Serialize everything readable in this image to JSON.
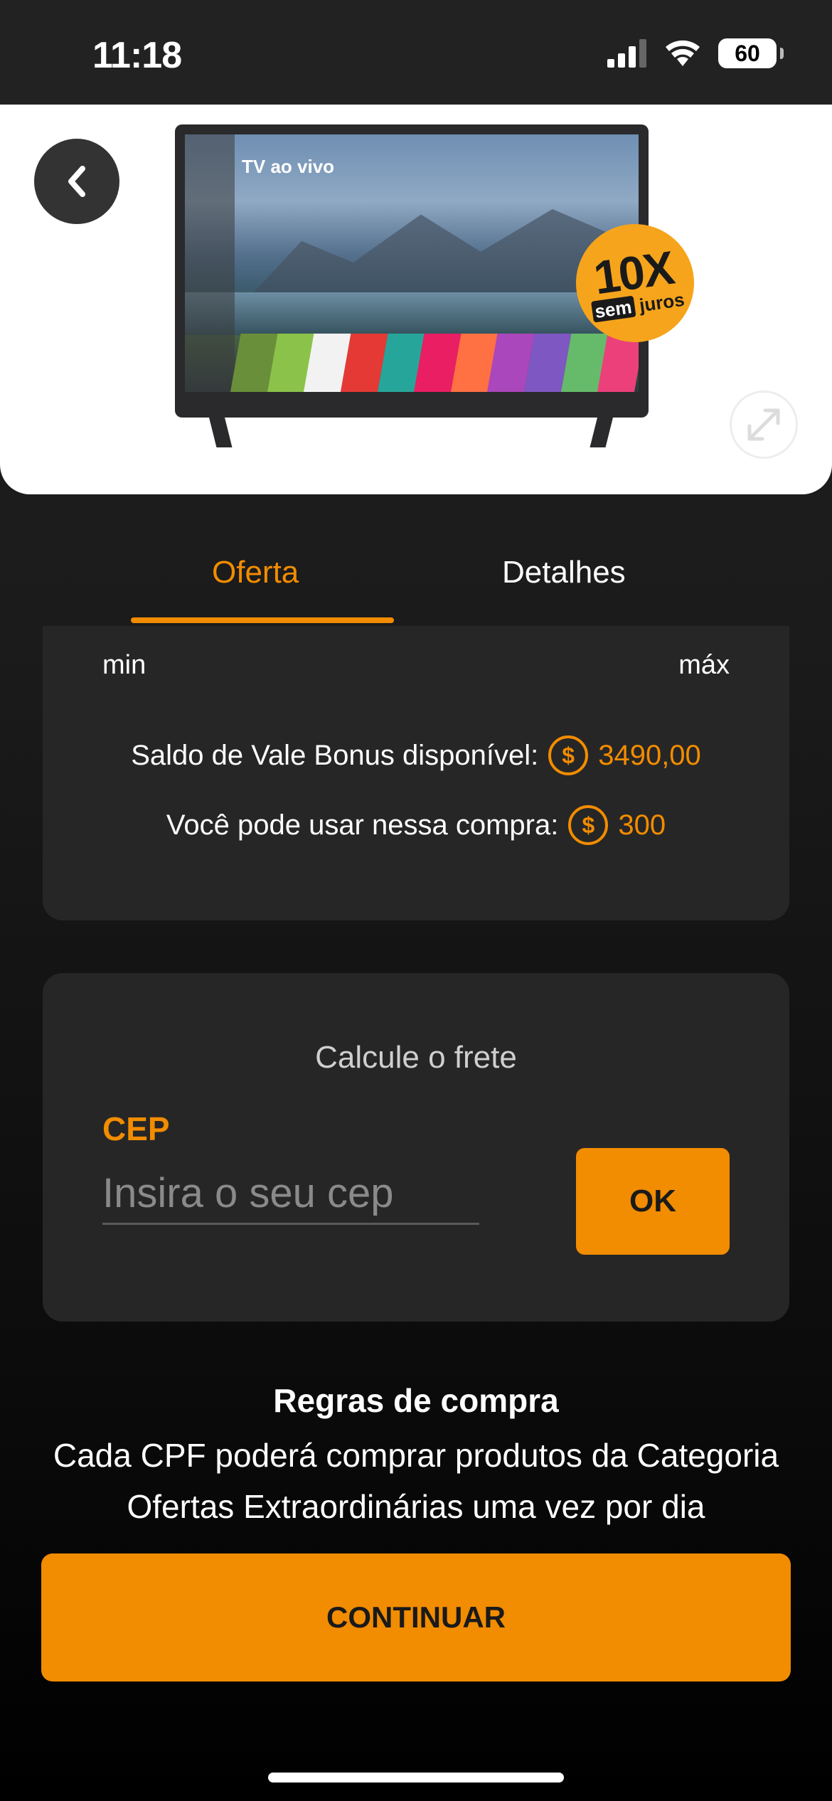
{
  "status_bar": {
    "time": "11:18",
    "battery": "60"
  },
  "product": {
    "tv_screen_title": "TV ao vivo",
    "badge_big": "10X",
    "badge_sem": "sem",
    "badge_juros": "juros"
  },
  "tabs": [
    {
      "label": "Oferta",
      "active": true
    },
    {
      "label": "Detalhes",
      "active": false
    }
  ],
  "bonus": {
    "range_min": "min",
    "range_max": "máx",
    "saldo_label": "Saldo de Vale Bonus disponível:",
    "saldo_value": "3490,00",
    "uso_label": "Você pode usar nessa compra:",
    "uso_value": "300",
    "coin_symbol": "$"
  },
  "frete": {
    "title": "Calcule o frete",
    "cep_label": "CEP",
    "cep_placeholder": "Insira o seu cep",
    "ok_label": "OK"
  },
  "rules": {
    "title": "Regras de compra",
    "text": "Cada CPF poderá comprar produtos da Categoria Ofertas Extraordinárias uma vez por dia"
  },
  "continue_label": "CONTINUAR",
  "colors": {
    "accent": "#f28c00",
    "card": "#262626",
    "background": "#1b1b1b"
  },
  "icons": [
    "back-arrow-icon",
    "expand-icon",
    "signal-icon",
    "wifi-icon",
    "battery-icon",
    "coin-icon"
  ]
}
